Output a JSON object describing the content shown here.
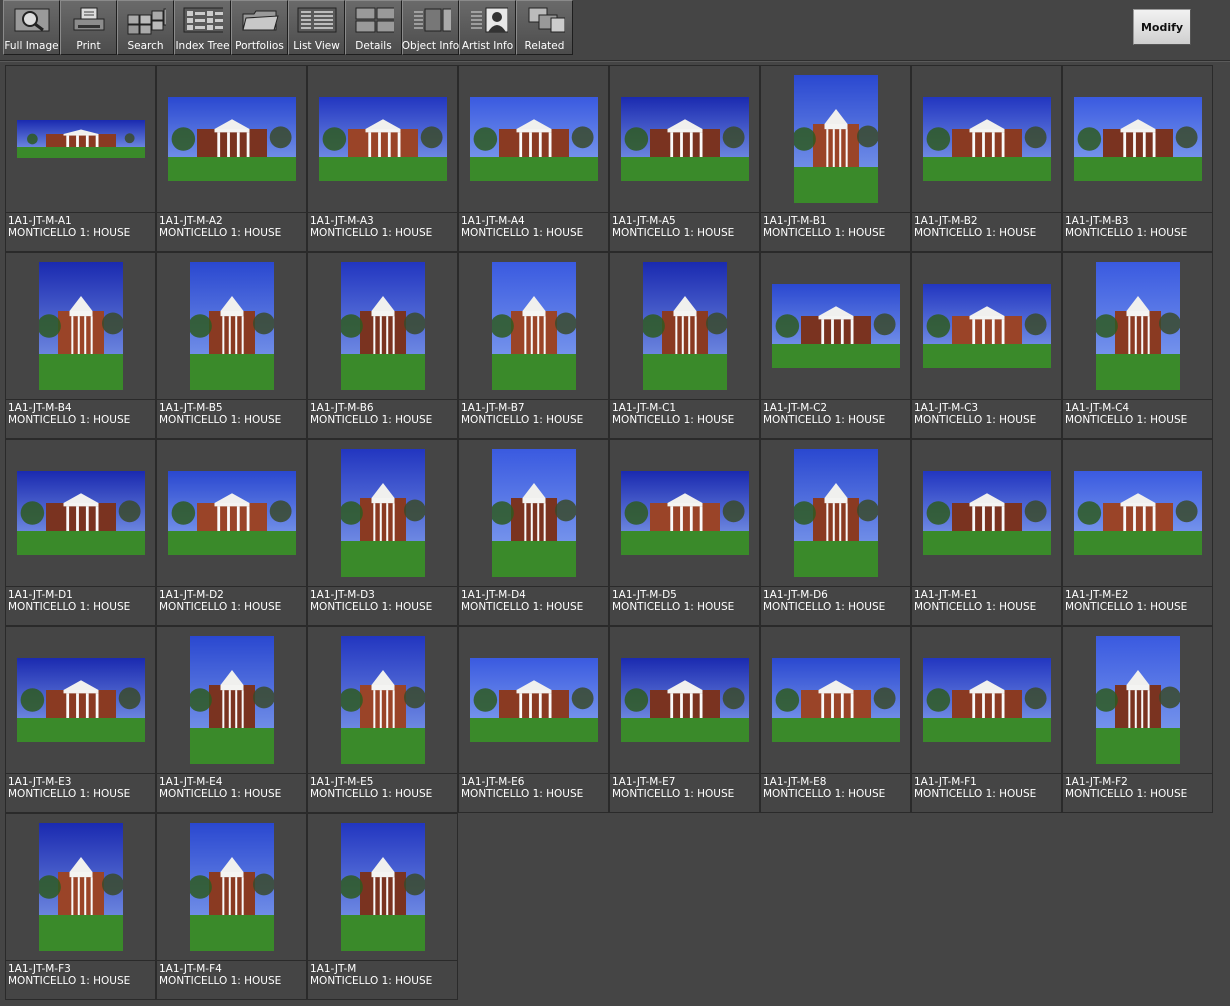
{
  "toolbar": {
    "buttons": [
      {
        "label": "Full Image",
        "icon": "magnifier-icon"
      },
      {
        "label": "Print",
        "icon": "printer-icon"
      },
      {
        "label": "Search",
        "icon": "search-grid-icon"
      },
      {
        "label": "Index Tree",
        "icon": "index-tree-icon"
      },
      {
        "label": "Portfolios",
        "icon": "folder-icon"
      },
      {
        "label": "List View",
        "icon": "list-view-icon"
      },
      {
        "label": "Details",
        "icon": "details-grid-icon"
      },
      {
        "label": "Object Info",
        "icon": "object-info-icon"
      },
      {
        "label": "Artist  Info",
        "icon": "artist-info-icon"
      },
      {
        "label": "Related",
        "icon": "related-icon"
      }
    ],
    "modify_label": "Modify"
  },
  "items": [
    {
      "id": "1A1-JT-M-A1",
      "title": "MONTICELLO 1: HOUSE",
      "orientation": "wide"
    },
    {
      "id": "1A1-JT-M-A2",
      "title": "MONTICELLO 1: HOUSE",
      "orientation": "landscape"
    },
    {
      "id": "1A1-JT-M-A3",
      "title": "MONTICELLO 1: HOUSE",
      "orientation": "landscape"
    },
    {
      "id": "1A1-JT-M-A4",
      "title": "MONTICELLO 1: HOUSE",
      "orientation": "landscape"
    },
    {
      "id": "1A1-JT-M-A5",
      "title": "MONTICELLO 1: HOUSE",
      "orientation": "landscape"
    },
    {
      "id": "1A1-JT-M-B1",
      "title": "MONTICELLO 1: HOUSE",
      "orientation": "portrait"
    },
    {
      "id": "1A1-JT-M-B2",
      "title": "MONTICELLO 1: HOUSE",
      "orientation": "landscape"
    },
    {
      "id": "1A1-JT-M-B3",
      "title": "MONTICELLO 1: HOUSE",
      "orientation": "landscape"
    },
    {
      "id": "1A1-JT-M-B4",
      "title": "MONTICELLO 1: HOUSE",
      "orientation": "portrait"
    },
    {
      "id": "1A1-JT-M-B5",
      "title": "MONTICELLO 1: HOUSE",
      "orientation": "portrait"
    },
    {
      "id": "1A1-JT-M-B6",
      "title": "MONTICELLO 1: HOUSE",
      "orientation": "portrait"
    },
    {
      "id": "1A1-JT-M-B7",
      "title": "MONTICELLO 1: HOUSE",
      "orientation": "portrait"
    },
    {
      "id": "1A1-JT-M-C1",
      "title": "MONTICELLO 1: HOUSE",
      "orientation": "portrait"
    },
    {
      "id": "1A1-JT-M-C2",
      "title": "MONTICELLO 1: HOUSE",
      "orientation": "landscape"
    },
    {
      "id": "1A1-JT-M-C3",
      "title": "MONTICELLO 1: HOUSE",
      "orientation": "landscape"
    },
    {
      "id": "1A1-JT-M-C4",
      "title": "MONTICELLO 1: HOUSE",
      "orientation": "portrait"
    },
    {
      "id": "1A1-JT-M-D1",
      "title": "MONTICELLO 1: HOUSE",
      "orientation": "landscape"
    },
    {
      "id": "1A1-JT-M-D2",
      "title": "MONTICELLO 1: HOUSE",
      "orientation": "landscape"
    },
    {
      "id": "1A1-JT-M-D3",
      "title": "MONTICELLO 1: HOUSE",
      "orientation": "portrait"
    },
    {
      "id": "1A1-JT-M-D4",
      "title": "MONTICELLO 1: HOUSE",
      "orientation": "portrait"
    },
    {
      "id": "1A1-JT-M-D5",
      "title": "MONTICELLO 1: HOUSE",
      "orientation": "landscape"
    },
    {
      "id": "1A1-JT-M-D6",
      "title": "MONTICELLO 1: HOUSE",
      "orientation": "portrait"
    },
    {
      "id": "1A1-JT-M-E1",
      "title": "MONTICELLO 1: HOUSE",
      "orientation": "landscape"
    },
    {
      "id": "1A1-JT-M-E2",
      "title": "MONTICELLO 1: HOUSE",
      "orientation": "landscape"
    },
    {
      "id": "1A1-JT-M-E3",
      "title": "MONTICELLO 1: HOUSE",
      "orientation": "landscape"
    },
    {
      "id": "1A1-JT-M-E4",
      "title": "MONTICELLO 1: HOUSE",
      "orientation": "portrait"
    },
    {
      "id": "1A1-JT-M-E5",
      "title": "MONTICELLO 1: HOUSE",
      "orientation": "portrait"
    },
    {
      "id": "1A1-JT-M-E6",
      "title": "MONTICELLO 1: HOUSE",
      "orientation": "landscape"
    },
    {
      "id": "1A1-JT-M-E7",
      "title": "MONTICELLO 1: HOUSE",
      "orientation": "landscape"
    },
    {
      "id": "1A1-JT-M-E8",
      "title": "MONTICELLO 1: HOUSE",
      "orientation": "landscape"
    },
    {
      "id": "1A1-JT-M-F1",
      "title": "MONTICELLO 1: HOUSE",
      "orientation": "landscape"
    },
    {
      "id": "1A1-JT-M-F2",
      "title": "MONTICELLO 1: HOUSE",
      "orientation": "portrait"
    },
    {
      "id": "1A1-JT-M-F3",
      "title": "MONTICELLO 1: HOUSE",
      "orientation": "portrait"
    },
    {
      "id": "1A1-JT-M-F4",
      "title": "MONTICELLO 1: HOUSE",
      "orientation": "portrait"
    },
    {
      "id": "1A1-JT-M",
      "title": "MONTICELLO 1: HOUSE",
      "orientation": "portrait"
    }
  ]
}
